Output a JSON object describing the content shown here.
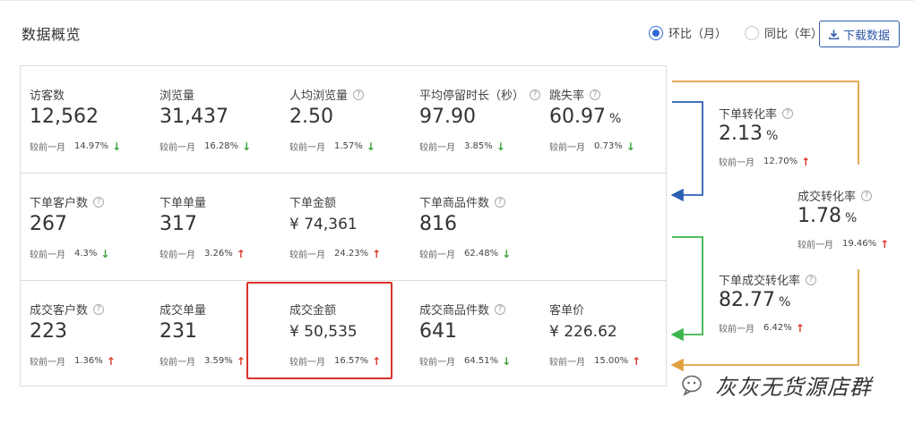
{
  "title": "数据概览",
  "period": {
    "options": [
      {
        "label": "环比（月）",
        "checked": true
      },
      {
        "label": "同比（年）",
        "checked": false
      }
    ]
  },
  "download_label": "下载数据",
  "compare_label": "较前一月",
  "rows": [
    [
      {
        "label": "访客数",
        "help": false,
        "value": "12,562",
        "unit": "",
        "pct": "14.97%",
        "trend": "down"
      },
      {
        "label": "浏览量",
        "help": false,
        "value": "31,437",
        "unit": "",
        "pct": "16.28%",
        "trend": "down"
      },
      {
        "label": "人均浏览量",
        "help": true,
        "value": "2.50",
        "unit": "",
        "pct": "1.57%",
        "trend": "down"
      },
      {
        "label": "平均停留时长（秒）",
        "help": true,
        "value": "97.90",
        "unit": "",
        "pct": "3.85%",
        "trend": "down"
      },
      {
        "label": "跳失率",
        "help": true,
        "value": "60.97",
        "unit": "%",
        "pct": "0.73%",
        "trend": "down"
      }
    ],
    [
      {
        "label": "下单客户数",
        "help": true,
        "value": "267",
        "unit": "",
        "pct": "4.3%",
        "trend": "down"
      },
      {
        "label": "下单单量",
        "help": false,
        "value": "317",
        "unit": "",
        "pct": "3.26%",
        "trend": "up"
      },
      {
        "label": "下单金额",
        "help": false,
        "value": "¥ 74,361",
        "unit": "",
        "pct": "24.23%",
        "trend": "up",
        "currency": true
      },
      {
        "label": "下单商品件数",
        "help": true,
        "value": "816",
        "unit": "",
        "pct": "62.48%",
        "trend": "down"
      }
    ],
    [
      {
        "label": "成交客户数",
        "help": true,
        "value": "223",
        "unit": "",
        "pct": "1.36%",
        "trend": "up"
      },
      {
        "label": "成交单量",
        "help": false,
        "value": "231",
        "unit": "",
        "pct": "3.59%",
        "trend": "up"
      },
      {
        "label": "成交金额",
        "help": false,
        "value": "¥ 50,535",
        "unit": "",
        "pct": "16.57%",
        "trend": "up",
        "currency": true
      },
      {
        "label": "成交商品件数",
        "help": true,
        "value": "641",
        "unit": "",
        "pct": "64.51%",
        "trend": "down"
      },
      {
        "label": "客单价",
        "help": false,
        "value": "¥ 226.62",
        "unit": "",
        "pct": "15.00%",
        "trend": "up",
        "currency": true
      }
    ]
  ],
  "conversions": {
    "order_rate": {
      "label": "下单转化率",
      "value": "2.13",
      "unit": "%",
      "pct": "12.70%",
      "trend": "up"
    },
    "deal_rate": {
      "label": "成交转化率",
      "value": "1.78",
      "unit": "%",
      "pct": "19.46%",
      "trend": "up"
    },
    "order_deal_rate": {
      "label": "下单成交转化率",
      "value": "82.77",
      "unit": "%",
      "pct": "6.42%",
      "trend": "up"
    }
  },
  "watermark": "灰灰无货源店群",
  "colors": {
    "accent": "#2f6bd6",
    "up": "#d93a2e",
    "down": "#3aa53a",
    "blue_flow": "#2b5fb3",
    "green_flow": "#3bb54a",
    "orange_flow": "#e0a040",
    "highlight": "#d9322a"
  }
}
